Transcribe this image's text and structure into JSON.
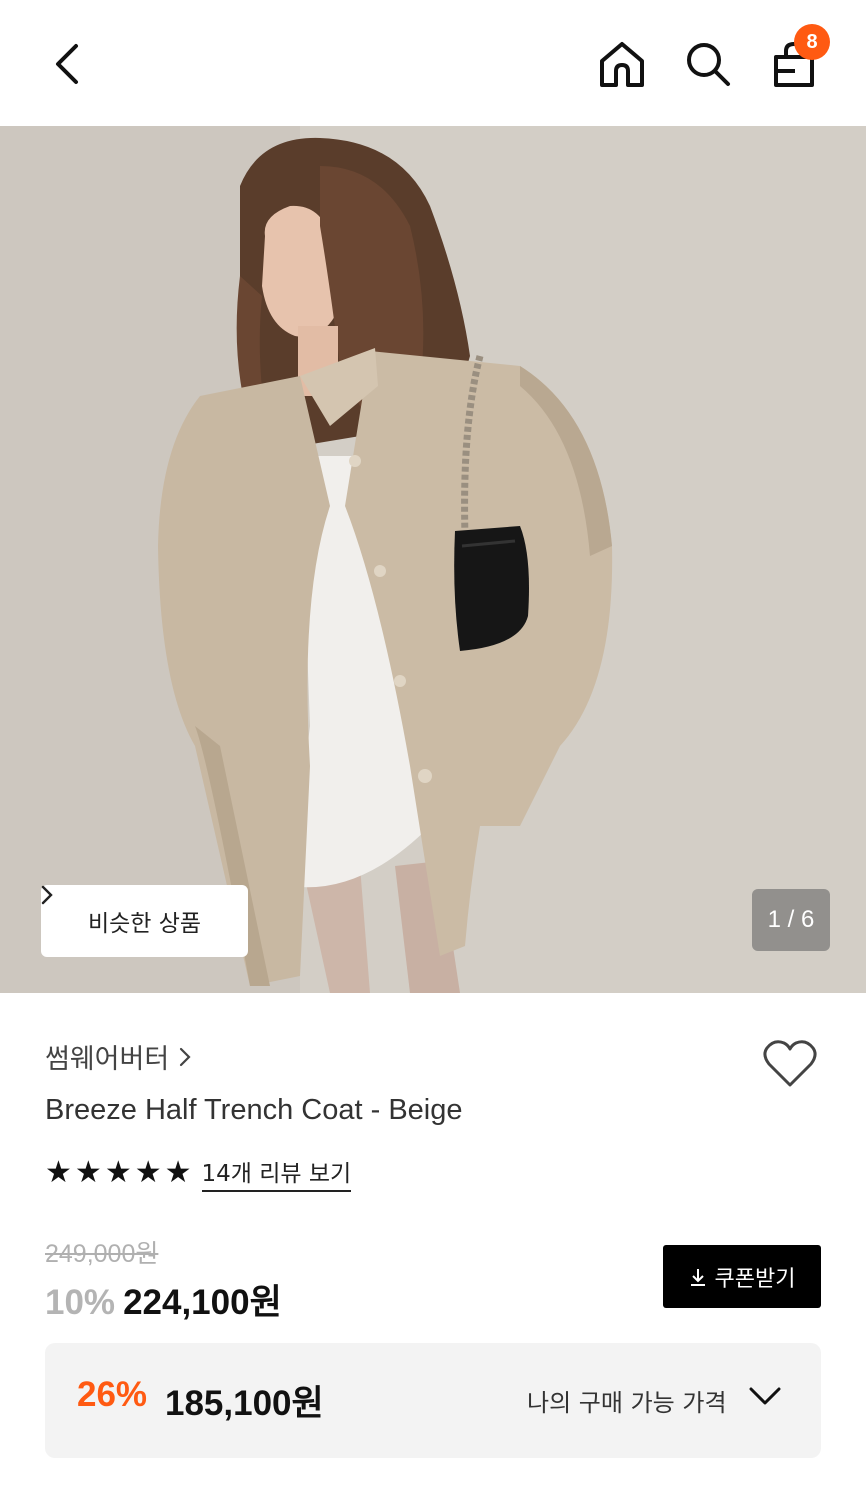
{
  "header": {
    "cart_count": "8",
    "icons": [
      "back-icon",
      "home-icon",
      "search-icon",
      "cart-icon"
    ]
  },
  "gallery": {
    "similar_label": "비슷한 상품",
    "counter": "1 / 6"
  },
  "product": {
    "brand": "썸웨어버터",
    "name": "Breeze Half Trench Coat - Beige",
    "stars": 5,
    "review_link": "14개 리뷰 보기",
    "original_price": "249,000원",
    "discount": "10%",
    "price": "224,100원",
    "coupon_label": "쿠폰받기"
  },
  "my_price": {
    "discount": "26%",
    "price": "185,100원",
    "label": "나의 구매 가능 가격"
  },
  "colors": {
    "accent": "#ff5a12",
    "coupon_bg": "#000000",
    "panel_bg": "#f3f3f3"
  }
}
